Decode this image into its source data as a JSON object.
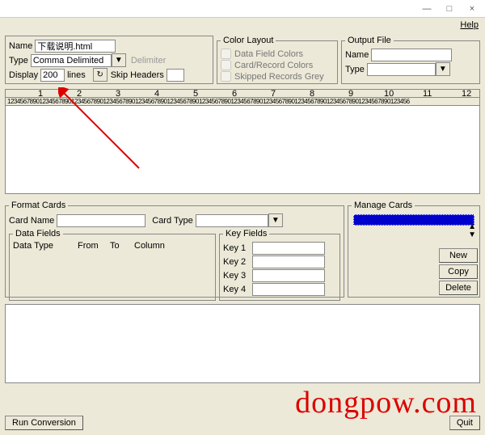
{
  "window": {
    "minimize": "—",
    "maximize": "□",
    "close": "×"
  },
  "menu": {
    "help": "Help"
  },
  "input_group": {
    "name_lbl": "Name",
    "name_val": "下载说明.html",
    "type_lbl": "Type",
    "type_val": "Comma Delimited",
    "display_lbl": "Display",
    "display_val": "200",
    "lines_lbl": "lines",
    "delim_lbl": "Delimiter",
    "skip_lbl": "Skip Headers"
  },
  "color_group": {
    "title": "Color Layout",
    "opt1": "Data Field Colors",
    "opt2": "Card/Record Colors",
    "opt3": "Skipped Records Grey"
  },
  "output_group": {
    "title": "Output File",
    "name_lbl": "Name",
    "type_lbl": "Type"
  },
  "ruler_digits": "123456789012345678901234567890123456789012345678901234567890123456789012345678901234567890123456789012345678901234567890123456",
  "format_cards": {
    "title": "Format Cards",
    "cardname_lbl": "Card Name",
    "cardtype_lbl": "Card Type",
    "datafields_title": "Data Fields",
    "col1": "Data Type",
    "col2": "From",
    "col3": "To",
    "col4": "Column",
    "keyfields_title": "Key Fields",
    "k1": "Key 1",
    "k2": "Key 2",
    "k3": "Key 3",
    "k4": "Key 4"
  },
  "manage": {
    "title": "Manage Cards",
    "new": "New",
    "copy": "Copy",
    "delete": "Delete"
  },
  "bottom": {
    "run": "Run Conversion",
    "quit": "Quit"
  },
  "watermark": "dongpow.com"
}
